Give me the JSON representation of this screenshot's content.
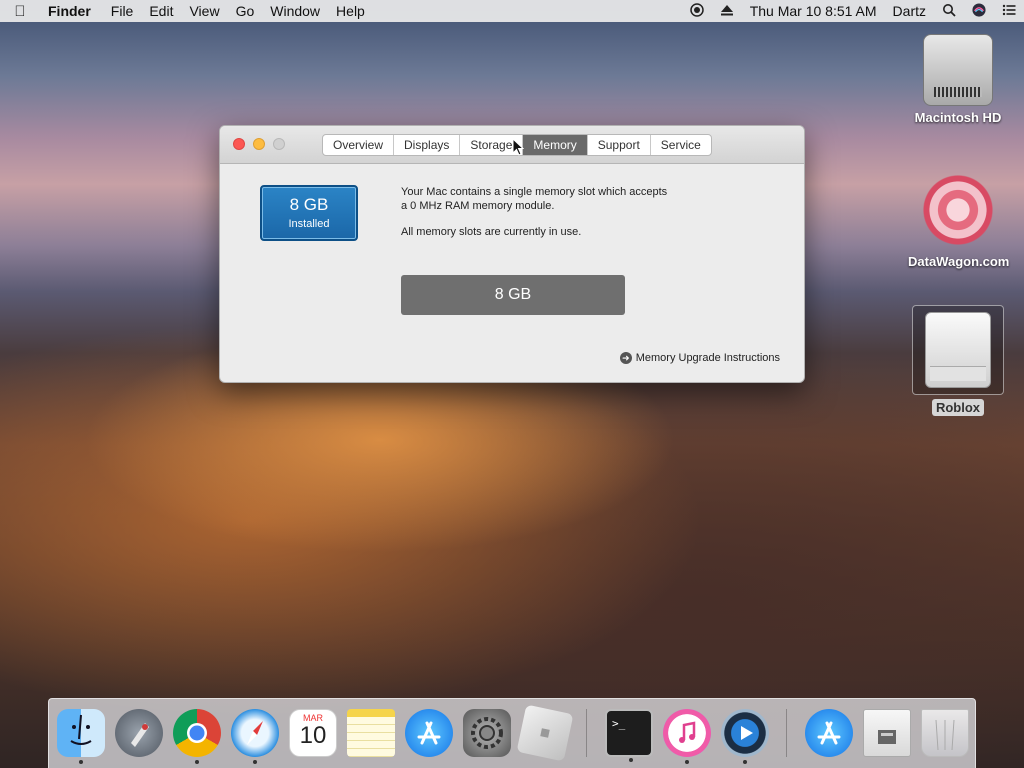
{
  "menubar": {
    "app_name": "Finder",
    "menus": [
      "File",
      "Edit",
      "View",
      "Go",
      "Window",
      "Help"
    ],
    "datetime": "Thu Mar 10  8:51 AM",
    "user": "Dartz"
  },
  "desktop": {
    "icons": [
      {
        "label": "Macintosh HD"
      },
      {
        "label": "DataWagon.com"
      },
      {
        "label": "Roblox"
      }
    ]
  },
  "window": {
    "tabs": [
      "Overview",
      "Displays",
      "Storage",
      "Memory",
      "Support",
      "Service"
    ],
    "active_tab": "Memory",
    "memory_badge": {
      "size": "8 GB",
      "caption": "Installed"
    },
    "description_line1": "Your Mac contains a single memory slot which accepts",
    "description_line2": "a 0 MHz RAM memory module.",
    "description_line3": "All memory slots are currently in use.",
    "slot_label": "8 GB",
    "upgrade_link": "Memory Upgrade Instructions"
  },
  "dock": {
    "apps": [
      "finder-icon",
      "launchpad-icon",
      "chrome-icon",
      "safari-icon",
      "calendar-icon",
      "notes-icon",
      "app-store-icon",
      "system-preferences-icon",
      "roblox-icon",
      "terminal-icon",
      "itunes-icon",
      "quicktime-icon",
      "app-store-download-icon",
      "archive-icon",
      "trash-icon"
    ],
    "calendar_month": "MAR",
    "calendar_day": "10"
  }
}
